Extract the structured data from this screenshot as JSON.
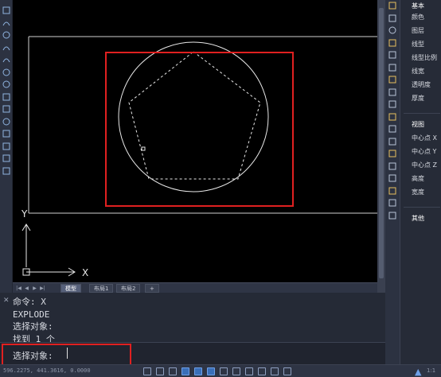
{
  "tabs": [
    {
      "label": "模型",
      "active": true
    },
    {
      "label": "布局1",
      "active": false
    },
    {
      "label": "布局2",
      "active": false
    },
    {
      "label": "+",
      "active": false
    }
  ],
  "axes": {
    "x_label": "X",
    "y_label": "Y"
  },
  "command_history": [
    "命令: X",
    "EXPLODE",
    "选择对象:",
    "找到 1 个"
  ],
  "command_prompt": "选择对象:",
  "status": {
    "coords": "596.2275, 441.3616, 0.0000",
    "scale": "1:1"
  },
  "properties": {
    "section_basic": "基本",
    "basic_items": [
      "颜色",
      "图层",
      "线型",
      "线型比例",
      "线宽",
      "透明度",
      "厚度"
    ],
    "section_view": "视图",
    "view_items": [
      "中心点 X",
      "中心点 Y",
      "中心点 Z",
      "高度",
      "宽度"
    ],
    "section_other": "其他"
  },
  "colors": {
    "canvas": "#000000",
    "selection_highlight": "#e02020",
    "geometry": "#ffffff",
    "active_button": "#3a6fb8"
  },
  "left_tools": [
    "rectangle-icon",
    "arc-icon",
    "circle-icon",
    "revision-cloud-icon",
    "spline-icon",
    "ellipse-icon",
    "ellipse-arc-icon",
    "insert-block-icon",
    "make-block-icon",
    "point-icon",
    "hatch-icon",
    "gradient-icon",
    "region-icon",
    "table-icon"
  ],
  "right_tools": [
    "cursor-icon",
    "move-icon",
    "rotate-icon",
    "trim-icon",
    "extend-icon",
    "break-icon",
    "join-icon",
    "chamfer-icon",
    "fillet-icon",
    "array-icon",
    "scale-icon",
    "stretch-icon",
    "explode-icon",
    "erase-icon",
    "copy-icon",
    "mirror-icon",
    "offset-icon",
    "properties-icon"
  ]
}
